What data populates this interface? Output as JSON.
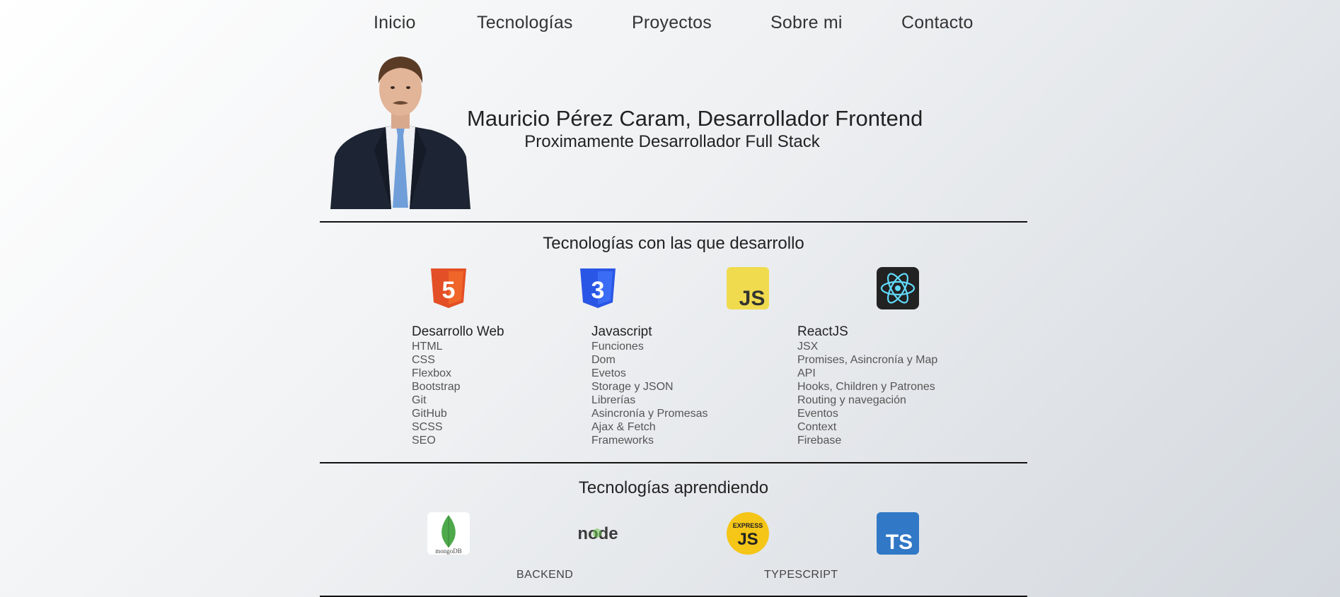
{
  "nav": {
    "items": [
      {
        "label": "Inicio"
      },
      {
        "label": "Tecnologías"
      },
      {
        "label": "Proyectos"
      },
      {
        "label": "Sobre mi"
      },
      {
        "label": "Contacto"
      }
    ]
  },
  "hero": {
    "title": "Mauricio Pérez Caram, Desarrollador Frontend",
    "subtitle": "Proximamente Desarrollador Full Stack"
  },
  "tech_section": {
    "title": "Tecnologías con las que desarrollo",
    "icons": [
      {
        "name": "html5-icon",
        "label": "5"
      },
      {
        "name": "css3-icon",
        "label": "3"
      },
      {
        "name": "javascript-icon",
        "label": "JS"
      },
      {
        "name": "react-icon",
        "label": ""
      }
    ],
    "columns": [
      {
        "title": "Desarrollo Web",
        "items": [
          "HTML",
          "CSS",
          "Flexbox",
          "Bootstrap",
          "Git",
          "GitHub",
          "SCSS",
          "SEO"
        ]
      },
      {
        "title": "Javascript",
        "items": [
          "Funciones",
          "Dom",
          "Evetos",
          "Storage y JSON",
          "Librerías",
          "Asincronía y Promesas",
          "Ajax & Fetch",
          "Frameworks"
        ]
      },
      {
        "title": "ReactJS",
        "items": [
          "JSX",
          "Promises, Asincronía y Map",
          "API",
          "Hooks, Children y Patrones",
          "Routing y navegación",
          "Eventos",
          "Context",
          "Firebase"
        ]
      }
    ]
  },
  "learning_section": {
    "title": "Tecnologías aprendiendo",
    "icons": [
      {
        "name": "mongodb-icon",
        "label": "mongoDB"
      },
      {
        "name": "nodejs-icon",
        "label": "node"
      },
      {
        "name": "expressjs-icon",
        "label_top": "EXPRESS",
        "label_main": "JS"
      },
      {
        "name": "typescript-icon",
        "label": "TS"
      }
    ],
    "labels": [
      "BACKEND",
      "TYPESCRIPT"
    ]
  },
  "colors": {
    "html5": "#e34f26",
    "css3": "#1572b6",
    "javascript": "#f0db4f",
    "react_bg": "#222222",
    "react": "#61dafb",
    "mongodb_leaf": "#4ea94b",
    "express": "#f5c518",
    "typescript": "#3178c6"
  }
}
